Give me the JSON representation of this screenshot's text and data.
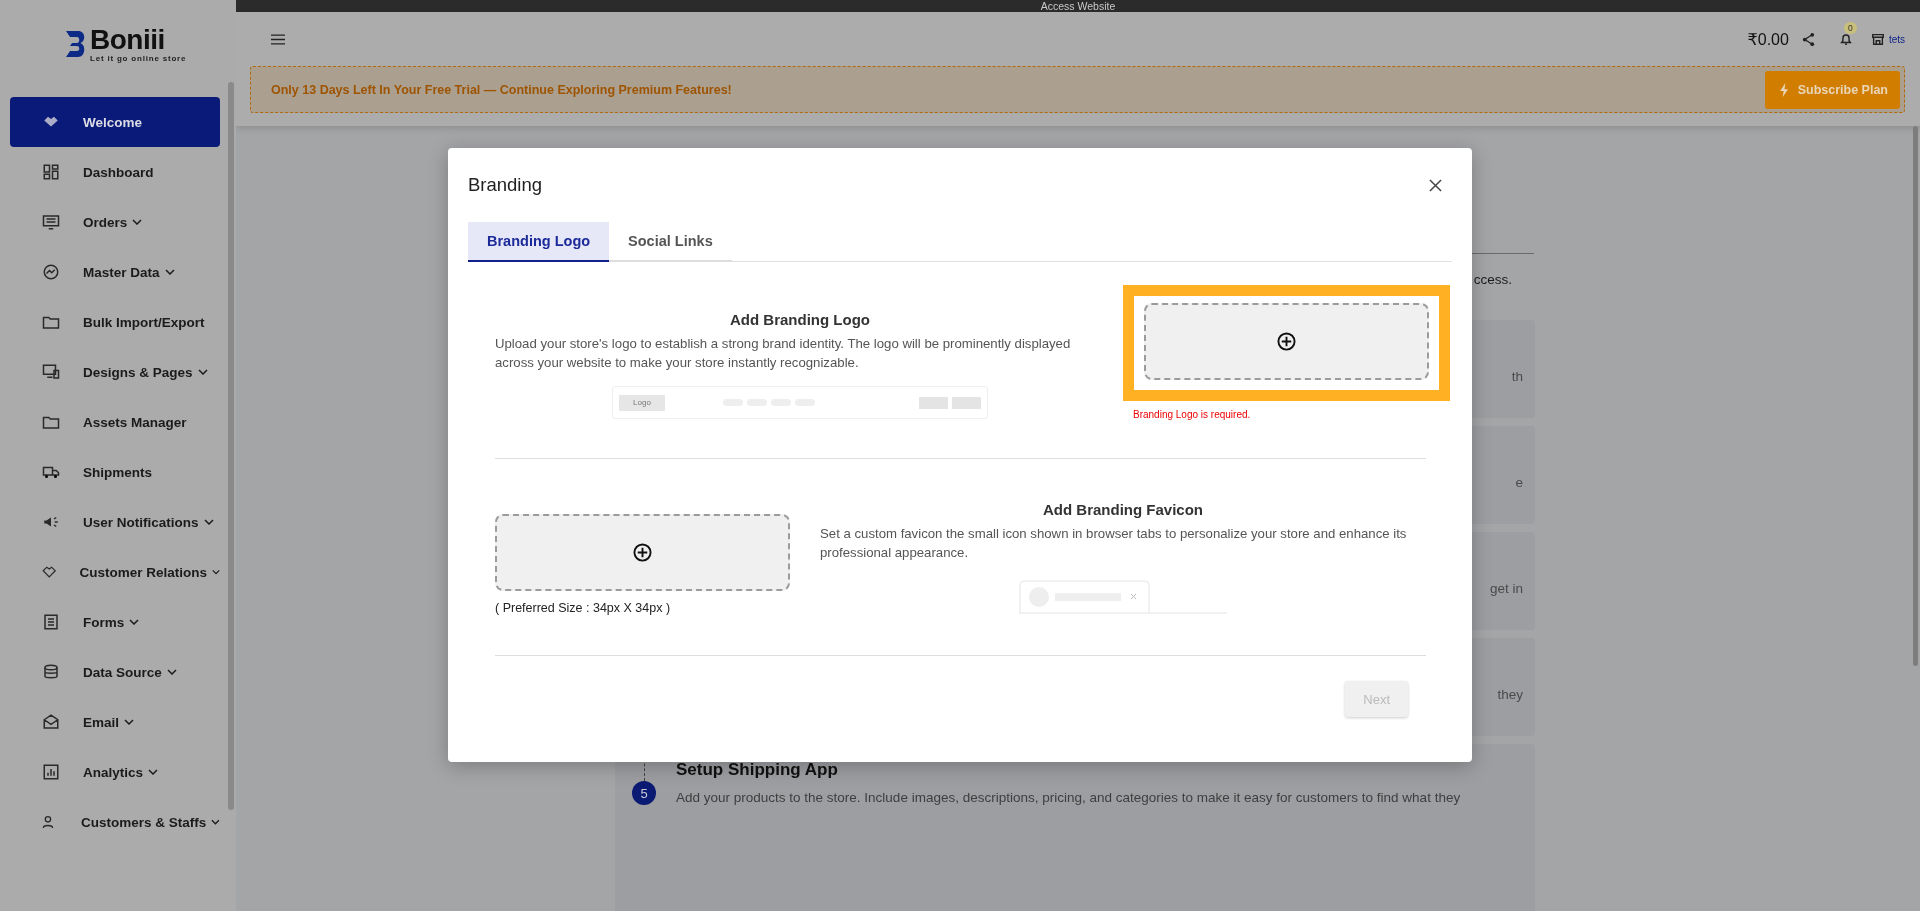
{
  "top_strip": {
    "title": "Access Website"
  },
  "sidebar": {
    "logo": {
      "name": "Boniii",
      "tagline": "Let it go online store"
    },
    "items": [
      {
        "label": "Welcome",
        "expandable": false,
        "selected": true
      },
      {
        "label": "Dashboard",
        "expandable": false,
        "selected": false
      },
      {
        "label": "Orders",
        "expandable": true,
        "selected": false
      },
      {
        "label": "Master Data",
        "expandable": true,
        "selected": false
      },
      {
        "label": "Bulk Import/Export",
        "expandable": false,
        "selected": false
      },
      {
        "label": "Designs & Pages",
        "expandable": true,
        "selected": false
      },
      {
        "label": "Assets Manager",
        "expandable": false,
        "selected": false
      },
      {
        "label": "Shipments",
        "expandable": false,
        "selected": false
      },
      {
        "label": "User Notifications",
        "expandable": true,
        "selected": false
      },
      {
        "label": "Customer Relations",
        "expandable": true,
        "selected": false
      },
      {
        "label": "Forms",
        "expandable": true,
        "selected": false
      },
      {
        "label": "Data Source",
        "expandable": true,
        "selected": false
      },
      {
        "label": "Email",
        "expandable": true,
        "selected": false
      },
      {
        "label": "Analytics",
        "expandable": true,
        "selected": false
      },
      {
        "label": "Customers & Staffs",
        "expandable": true,
        "selected": false
      }
    ]
  },
  "header": {
    "balance": "₹0.00",
    "notification_count": "0",
    "store": "tets"
  },
  "banner": {
    "message": "Only 13 Days Left In Your Free Trial — Continue Exploring Premium Features!",
    "button": "Subscribe Plan"
  },
  "background_page": {
    "intro_fragment": "ccess.",
    "cards": [
      {
        "fragment": "th"
      },
      {
        "fragment": "e"
      },
      {
        "fragment": "get in"
      },
      {
        "fragment": "they"
      }
    ],
    "step": {
      "number": "5",
      "title": "Setup Shipping App",
      "description": "Add your products to the store. Include images, descriptions, pricing, and categories to make it easy for customers to find what they"
    }
  },
  "modal": {
    "title": "Branding",
    "tabs": [
      {
        "label": "Branding Logo",
        "selected": true
      },
      {
        "label": "Social Links",
        "selected": false
      }
    ],
    "sections": [
      {
        "kind": "logo",
        "heading": "Add Branding Logo",
        "description": "Upload your store's logo to establish a strong brand identity. The logo will be prominently displayed across your website to make your store instantly recognizable.",
        "preview_label": "Logo",
        "error": "Branding Logo is required.",
        "highlighted": true
      },
      {
        "kind": "favicon",
        "heading": "Add Branding Favicon",
        "description": "Set a custom favicon the small icon shown in browser tabs to personalize your store and enhance its professional appearance.",
        "size_hint": "( Preferred Size : 34px X 34px )",
        "highlighted": false
      }
    ],
    "next_button": {
      "label": "Next",
      "disabled": true
    }
  }
}
